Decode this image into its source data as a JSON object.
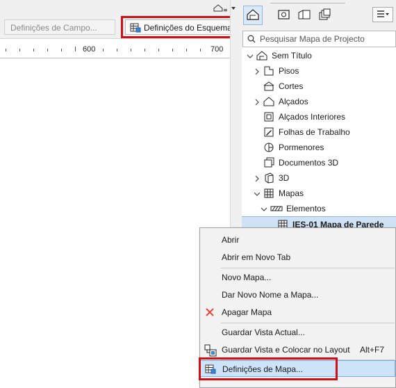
{
  "left_toolbar": {
    "campo_button": "Definições de Campo...",
    "esquema_button": "Definições do Esquema..."
  },
  "ruler": {
    "labels": [
      "600",
      "700"
    ]
  },
  "navigator": {
    "search_placeholder": "Pesquisar Mapa de Projecto",
    "tree": {
      "root": "Sem Título",
      "items": {
        "pisos": "Pisos",
        "cortes": "Cortes",
        "alcados": "Alçados",
        "alcados_interiores": "Alçados Interiores",
        "folhas_trabalho": "Folhas de Trabalho",
        "pormenores": "Pormenores",
        "documentos_3d": "Documentos 3D",
        "tres_d": "3D",
        "mapas": "Mapas",
        "elementos": "Elementos",
        "ies01": "IES-01 Mapa de Parede"
      }
    }
  },
  "context_menu": {
    "abrir": "Abrir",
    "abrir_novo_tab": "Abrir em Novo Tab",
    "novo_mapa": "Novo Mapa...",
    "dar_novo_nome": "Dar Novo Nome a Mapa...",
    "apagar_mapa": "Apagar Mapa",
    "guardar_vista": "Guardar Vista Actual...",
    "guardar_colocar": "Guardar Vista e Colocar no Layout",
    "guardar_colocar_shortcut": "Alt+F7",
    "definicoes_mapa": "Definições de Mapa..."
  },
  "colors": {
    "highlight_red": "#d01015",
    "selection_blue": "#cfe2f6",
    "delete_red": "#e8453c"
  }
}
